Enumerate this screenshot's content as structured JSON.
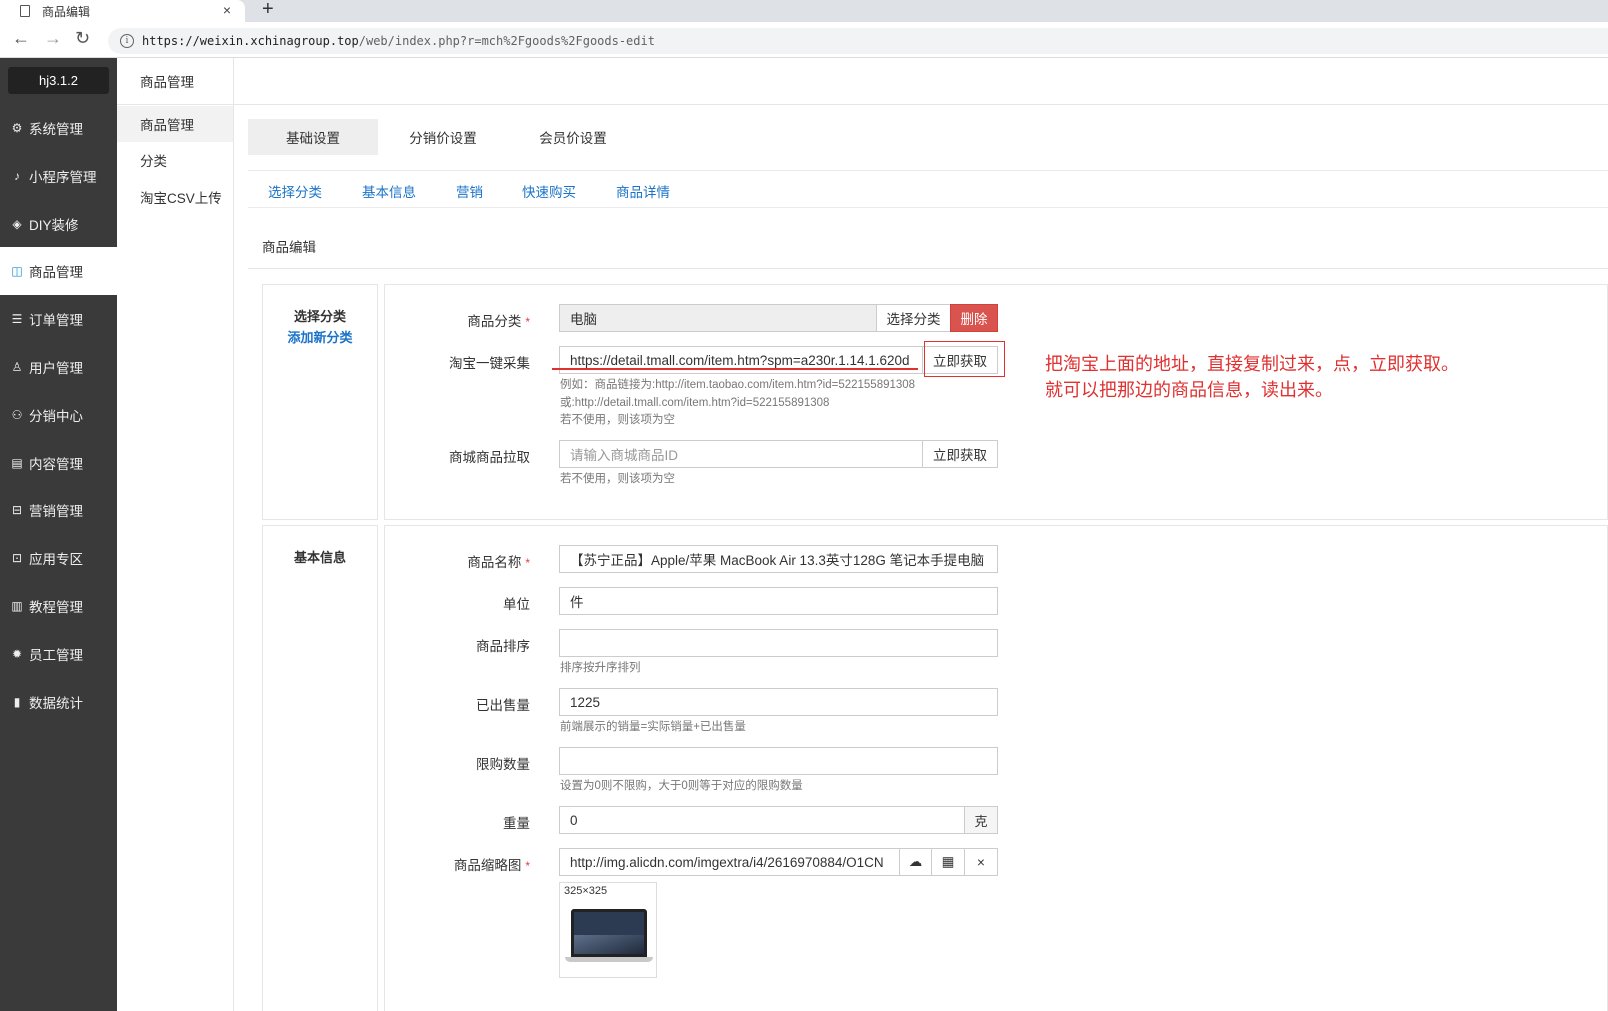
{
  "browser": {
    "tab_title": "商品编辑",
    "tab_close": "×",
    "new_tab": "+",
    "url_host": "https://weixin.xchinagroup.top",
    "url_path": "/web/index.php?r=mch%2Fgoods%2Fgoods-edit",
    "back": "←",
    "forward": "→",
    "reload": "↻",
    "info": "i"
  },
  "sidebar": {
    "version": "hj3.1.2",
    "items": [
      {
        "label": "系统管理",
        "icon": "gear-icon",
        "glyph": "⚙"
      },
      {
        "label": "小程序管理",
        "icon": "tiktok-icon",
        "glyph": "♪"
      },
      {
        "label": "DIY装修",
        "icon": "diamond-icon",
        "glyph": "◈"
      },
      {
        "label": "商品管理",
        "icon": "bag-icon",
        "glyph": "◫"
      },
      {
        "label": "订单管理",
        "icon": "list-icon",
        "glyph": "☰"
      },
      {
        "label": "用户管理",
        "icon": "user-icon",
        "glyph": "♙"
      },
      {
        "label": "分销中心",
        "icon": "sitemap-icon",
        "glyph": "⚇"
      },
      {
        "label": "内容管理",
        "icon": "content-icon",
        "glyph": "▤"
      },
      {
        "label": "营销管理",
        "icon": "ticket-icon",
        "glyph": "⊟"
      },
      {
        "label": "应用专区",
        "icon": "apps-icon",
        "glyph": "⊡"
      },
      {
        "label": "教程管理",
        "icon": "book-icon",
        "glyph": "▥"
      },
      {
        "label": "员工管理",
        "icon": "cog-icon",
        "glyph": "✹"
      },
      {
        "label": "数据统计",
        "icon": "bar-chart-icon",
        "glyph": "▮"
      }
    ]
  },
  "subsidebar": {
    "title": "商品管理",
    "items": [
      "商品管理",
      "分类",
      "淘宝CSV上传"
    ]
  },
  "tabs": [
    "基础设置",
    "分销价设置",
    "会员价设置"
  ],
  "anchors": [
    "选择分类",
    "基本信息",
    "营销",
    "快速购买",
    "商品详情"
  ],
  "section_title": "商品编辑",
  "category_card": {
    "title": "选择分类",
    "add_link": "添加新分类",
    "category_label": "商品分类",
    "required": "*",
    "category_value": "电脑",
    "choose_btn": "选择分类",
    "delete_btn": "删除",
    "taobao_label": "淘宝一键采集",
    "taobao_value": "https://detail.tmall.com/item.htm?spm=a230r.1.14.1.620d",
    "fetch_btn": "立即获取",
    "help1": "例如：商品链接为:http://item.taobao.com/item.htm?id=522155891308",
    "help2": "或:http://detail.tmall.com/item.htm?id=522155891308",
    "help3": "若不使用，则该项为空",
    "mall_label": "商城商品拉取",
    "mall_placeholder": "请输入商城商品ID",
    "mall_btn": "立即获取",
    "mall_help": "若不使用，则该项为空"
  },
  "annotation": {
    "line1": "把淘宝上面的地址，直接复制过来，点，立即获取。",
    "line2": "就可以把那边的商品信息，读出来。"
  },
  "basic_card": {
    "title": "基本信息",
    "name_label": "商品名称",
    "name_value": "【苏宁正品】Apple/苹果 MacBook Air 13.3英寸128G 笔记本手提电脑",
    "unit_label": "单位",
    "unit_value": "件",
    "sort_label": "商品排序",
    "sort_value": "",
    "sort_help": "排序按升序排列",
    "sold_label": "已出售量",
    "sold_value": "1225",
    "sold_help": "前端展示的销量=实际销量+已出售量",
    "limit_label": "限购数量",
    "limit_value": "",
    "limit_help": "设置为0则不限购，大于0则等于对应的限购数量",
    "weight_label": "重量",
    "weight_value": "0",
    "weight_unit": "克",
    "thumb_label": "商品缩略图",
    "thumb_value": "http://img.alicdn.com/imgextra/i4/2616970884/O1CN",
    "thumb_size": "325×325",
    "upload_glyph": "☁",
    "grid_glyph": "▦",
    "clear_glyph": "×"
  }
}
